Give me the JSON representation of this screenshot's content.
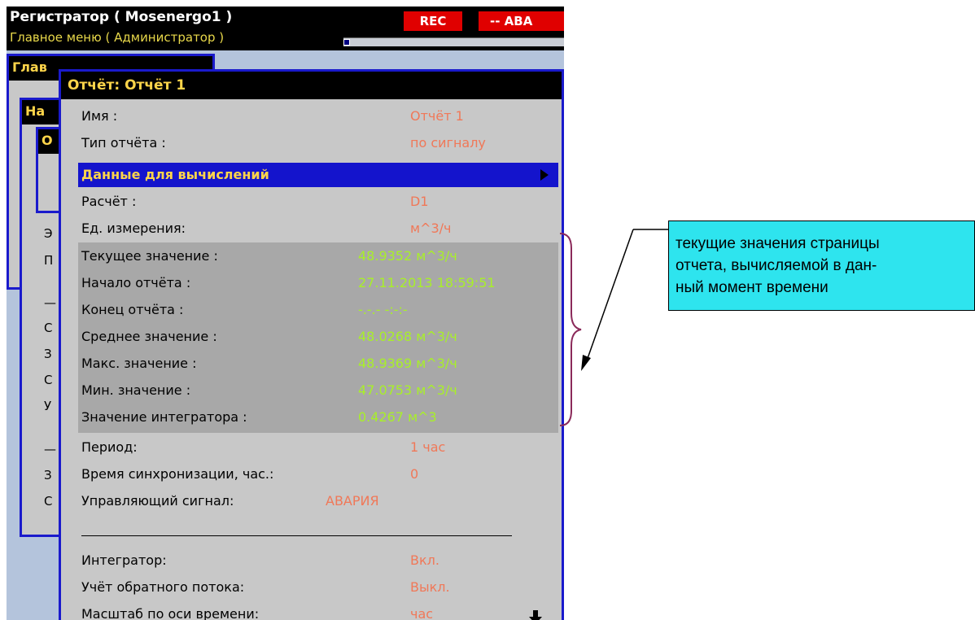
{
  "header": {
    "title": "Регистратор ( Mosenergo1 )",
    "subtitle": "Главное меню ( Администратор )",
    "rec": "REC",
    "alarm": "-- АВА"
  },
  "background_menus": {
    "menu1_title": "Глав",
    "menu2_title": "На",
    "menu3_title": "О",
    "side_chars": [
      "Э",
      "П",
      "—",
      "С",
      "З",
      "С",
      "У",
      "—",
      "З",
      "С"
    ]
  },
  "dialog": {
    "title": "Отчёт: Отчёт 1",
    "rows_top": [
      {
        "label": "Имя :",
        "value": "Отчёт 1"
      },
      {
        "label": "Тип отчёта :",
        "value": "по сигналу"
      }
    ],
    "selected": {
      "label": "Данные для вычислений"
    },
    "rows_mid": [
      {
        "label": "Расчёт :",
        "value": "D1"
      },
      {
        "label": "Ед. измерения:",
        "value": "м^3/ч"
      }
    ],
    "current": [
      {
        "label": "Текущее значение :",
        "value": "48.9352 м^3/ч"
      },
      {
        "label": "Начало отчёта :",
        "value": "27.11.2013 18:59:51"
      },
      {
        "label": "Конец отчёта :",
        "value": "-.-.- -:-:-"
      },
      {
        "label": "Среднее значение :",
        "value": "48.0268 м^3/ч"
      },
      {
        "label": "Макс. значение :",
        "value": "48.9369 м^3/ч"
      },
      {
        "label": "Мин. значение :",
        "value": "47.0753 м^3/ч"
      },
      {
        "label": "Значение интегратора :",
        "value": "0.4267 м^3"
      }
    ],
    "rows_bottom": [
      {
        "label": "Период:",
        "value": "1 час"
      },
      {
        "label": "Время синхронизации, час.:",
        "value": "0"
      },
      {
        "label": "Управляющий сигнал:",
        "value": "АВАРИЯ"
      }
    ],
    "rows_end": [
      {
        "label": "Интегратор:",
        "value": "Вкл."
      },
      {
        "label": "Учёт обратного потока:",
        "value": "Выкл."
      },
      {
        "label": "Масштаб по оси времени:",
        "value": "час"
      }
    ]
  },
  "annotation": {
    "lines": [
      "текущие значения страницы",
      "отчета, вычисляемой в дан-",
      "ный момент времени"
    ]
  },
  "colors": {
    "accent_yellow": "#ffd54a",
    "value_red": "#f07858",
    "value_green": "#a8f028",
    "selection_blue": "#1414cc",
    "annotation_cyan": "#2ee4ee"
  }
}
